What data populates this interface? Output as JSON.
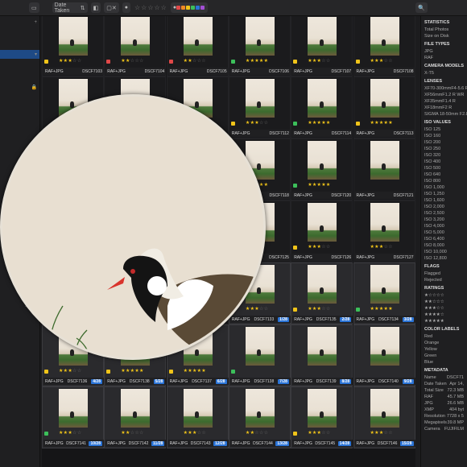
{
  "toolbar": {
    "sort_label": "Date Taken",
    "rating_filter": "☆☆☆☆☆"
  },
  "grid": {
    "cells": [
      {
        "name": "DSCF7103",
        "type": "RAF+JPG",
        "stars": 3,
        "flag": "#f0c419"
      },
      {
        "name": "DSCF7104",
        "type": "RAF+JPG",
        "stars": 2,
        "flag": "#e04848"
      },
      {
        "name": "DSCF7105",
        "type": "RAF+JPG",
        "stars": 2,
        "flag": "#e04848"
      },
      {
        "name": "DSCF7106",
        "type": "RAF+JPG",
        "stars": 5,
        "flag": "#3cbf5a"
      },
      {
        "name": "DSCF7107",
        "type": "RAF+JPG",
        "stars": 3,
        "flag": "#f0c419"
      },
      {
        "name": "DSCF7108",
        "type": "RAF+JPG",
        "stars": 3,
        "flag": "#f0c419"
      },
      {
        "name": "",
        "type": "",
        "stars": 0,
        "flag": ""
      },
      {
        "name": "",
        "type": "",
        "stars": 0,
        "flag": ""
      },
      {
        "name": "",
        "type": "",
        "stars": 0,
        "flag": ""
      },
      {
        "name": "DSCF7112",
        "type": "RAF+JPG",
        "stars": 3,
        "flag": "#f0c419"
      },
      {
        "name": "DSCF7114",
        "type": "RAF+JPG",
        "stars": 5,
        "flag": "#3cbf5a"
      },
      {
        "name": "DSCF7113",
        "type": "RAF+JPG",
        "stars": 5,
        "flag": "#f0c419"
      },
      {
        "name": "",
        "type": "",
        "stars": 0,
        "flag": ""
      },
      {
        "name": "",
        "type": "",
        "stars": 0,
        "flag": ""
      },
      {
        "name": "",
        "type": "",
        "stars": 0,
        "flag": ""
      },
      {
        "name": "DSCF7118",
        "type": "RAF+JPG",
        "stars": 5,
        "flag": "#f0c419"
      },
      {
        "name": "DSCF7120",
        "type": "RAF+JPG",
        "stars": 5,
        "flag": "#3cbf5a"
      },
      {
        "name": "DSCF7121",
        "type": "RAF+JPG",
        "stars": 0,
        "flag": ""
      },
      {
        "name": "",
        "type": "",
        "stars": 0,
        "flag": ""
      },
      {
        "name": "",
        "type": "",
        "stars": 0,
        "flag": ""
      },
      {
        "name": "",
        "type": "",
        "stars": 0,
        "flag": ""
      },
      {
        "name": "DSCF7125",
        "type": "RAF+JPG",
        "stars": 0,
        "flag": ""
      },
      {
        "name": "DSCF7126",
        "type": "RAF+JPG",
        "stars": 3,
        "flag": "#f0c419"
      },
      {
        "name": "DSCF7127",
        "type": "RAF+JPG",
        "stars": 3,
        "flag": ""
      },
      {
        "name": "",
        "type": "",
        "stars": 0,
        "flag": ""
      },
      {
        "name": "",
        "type": "",
        "stars": 0,
        "flag": ""
      },
      {
        "name": "",
        "type": "",
        "stars": 0,
        "flag": ""
      },
      {
        "name": "DSCF7133",
        "type": "RAF+JPG",
        "stars": 3,
        "flag": "#f0c419",
        "badge": "1/28"
      },
      {
        "name": "DSCF7135",
        "type": "RAF+JPG",
        "stars": 3,
        "flag": "#f0c419",
        "badge": "2/28"
      },
      {
        "name": "DSCF7134",
        "type": "RAF+JPG",
        "stars": 5,
        "flag": "#3cbf5a",
        "badge": "3/28"
      },
      {
        "name": "DSCF7136",
        "type": "RAF+JPG",
        "stars": 3,
        "flag": "#f0c419",
        "badge": "4/28"
      },
      {
        "name": "DSCF7138",
        "type": "RAF+JPG",
        "stars": 5,
        "flag": "#f0c419",
        "badge": "5/28"
      },
      {
        "name": "DSCF7137",
        "type": "RAF+JPG",
        "stars": 5,
        "flag": "#f0c419",
        "badge": "6/28"
      },
      {
        "name": "DSCF7138",
        "type": "RAF+JPG",
        "stars": 0,
        "flag": "#3cbf5a",
        "badge": "7/28"
      },
      {
        "name": "DSCF7139",
        "type": "RAF+JPG",
        "stars": 0,
        "flag": "",
        "badge": "8/28"
      },
      {
        "name": "DSCF7140",
        "type": "RAF+JPG",
        "stars": 0,
        "flag": "",
        "badge": "9/28"
      },
      {
        "name": "DSCF7141",
        "type": "RAF+JPG",
        "stars": 3,
        "flag": "#3cbf5a",
        "badge": "10/28"
      },
      {
        "name": "DSCF7142",
        "type": "RAF+JPG",
        "stars": 2,
        "flag": "",
        "badge": "11/28"
      },
      {
        "name": "DSCF7143",
        "type": "RAF+JPG",
        "stars": 3,
        "flag": "",
        "badge": "12/28"
      },
      {
        "name": "DSCF7144",
        "type": "RAF+JPG",
        "stars": 2,
        "flag": "",
        "badge": "13/28"
      },
      {
        "name": "DSCF7145",
        "type": "RAF+JPG",
        "stars": 3,
        "flag": "#f0c419",
        "badge": "14/28"
      },
      {
        "name": "DSCF7146",
        "type": "RAF+JPG",
        "stars": 3,
        "flag": "",
        "badge": "15/28"
      }
    ]
  },
  "stats": {
    "header": "STATISTICS",
    "total_photos_label": "Total Photos",
    "size_label": "Size on Disk",
    "file_types_header": "FILE TYPES",
    "file_types": [
      "JPG",
      "RAF"
    ],
    "camera_header": "CAMERA MODELS",
    "camera": "X-T5",
    "lenses_header": "LENSES",
    "lenses": [
      "XF70-300mmF4-5.6 R",
      "XF56mmF1.2 R WR",
      "XF35mmF1.4 R",
      "XF18mmF2 R",
      "SIGMA 18-50mm F2.8"
    ],
    "iso_header": "ISO VALUES",
    "iso": [
      "ISO 125",
      "ISO 160",
      "ISO 200",
      "ISO 250",
      "ISO 320",
      "ISO 400",
      "ISO 500",
      "ISO 640",
      "ISO 800",
      "ISO 1,000",
      "ISO 1,250",
      "ISO 1,600",
      "ISO 2,000",
      "ISO 2,500",
      "ISO 3,200",
      "ISO 4,000",
      "ISO 5,000",
      "ISO 6,400",
      "ISO 8,000",
      "ISO 10,000",
      "ISO 12,800"
    ],
    "flags_header": "FLAGS",
    "flags": [
      "Flagged",
      "Rejected"
    ],
    "ratings_header": "RATINGS",
    "ratings": [
      "★☆☆☆☆",
      "★★☆☆☆",
      "★★★☆☆",
      "★★★★☆",
      "★★★★★"
    ],
    "color_header": "COLOR LABELS",
    "colors": [
      "Red",
      "Orange",
      "Yellow",
      "Green",
      "Blue"
    ]
  },
  "metadata": {
    "header": "METADATA",
    "rows": [
      [
        "Name",
        "DSCF71"
      ],
      [
        "Date Taken",
        "Apr 14,"
      ],
      [
        "Total Size",
        "72.3 MB"
      ],
      [
        "RAF",
        "45.7 MB"
      ],
      [
        "JPG",
        "26.6 MB"
      ],
      [
        "XMP",
        "404 byt"
      ],
      [
        "Resolution",
        "7728 x 5"
      ],
      [
        "Megapixels",
        "39.8 MP"
      ],
      [
        "Camera",
        "FUJIFILM"
      ]
    ]
  },
  "sidebar": {
    "count": "9,604"
  }
}
